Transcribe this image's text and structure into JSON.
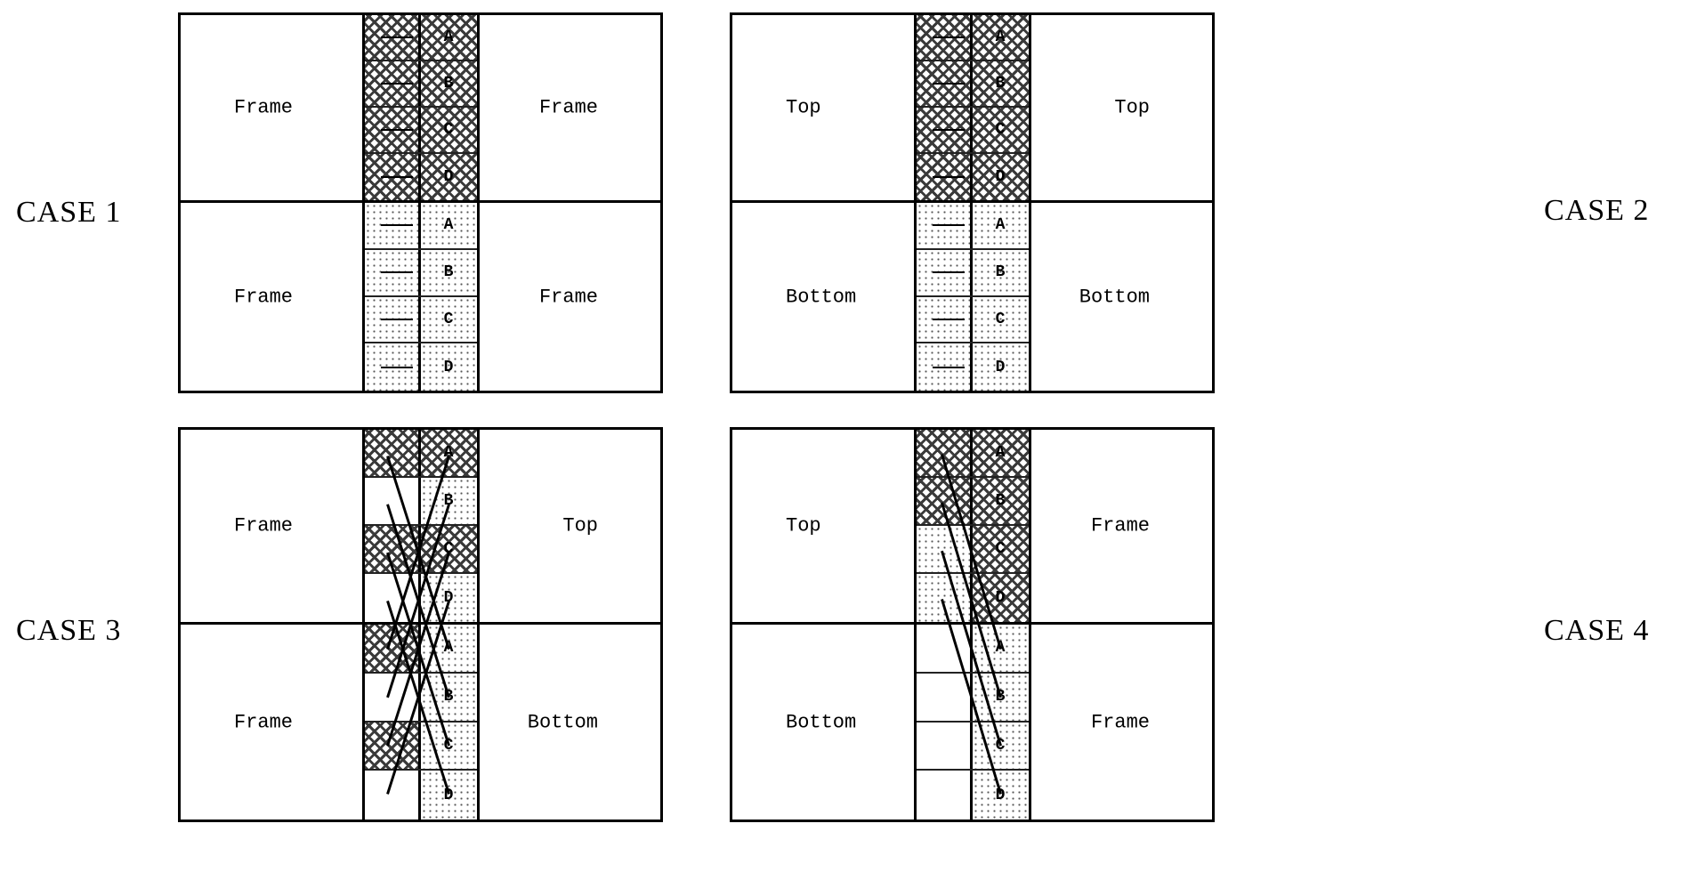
{
  "labels": {
    "case1": "CASE 1",
    "case2": "CASE 2",
    "case3": "CASE 3",
    "case4": "CASE 4"
  },
  "rows": [
    "A",
    "B",
    "C",
    "D"
  ],
  "cases": {
    "1": {
      "topLeft": "Frame",
      "topRight": "Frame",
      "bottomLeft": "Frame",
      "bottomRight": "Frame",
      "topPattern": "hatch",
      "bottomPattern": "dots",
      "topLeftCol": "hatch",
      "bottomLeftCol": "dots"
    },
    "2": {
      "topLeft": "Top",
      "topRight": "Top",
      "bottomLeft": "Bottom",
      "bottomRight": "Bottom",
      "topPattern": "hatch",
      "bottomPattern": "dots",
      "topLeftCol": "hatch",
      "bottomLeftCol": "dots"
    },
    "3": {
      "topLeft": "Frame",
      "topRight": "Top",
      "bottomLeft": "Frame",
      "bottomRight": "Bottom",
      "topRowPatterns": [
        "hatch",
        "plain",
        "hatch",
        "plain"
      ],
      "bottomRowPatterns": [
        "hatch",
        "plain",
        "hatch",
        "plain"
      ],
      "topRightPatterns": [
        "hatch",
        "dots",
        "hatch",
        "dots"
      ],
      "bottomRightPatterns": [
        "dots",
        "dots",
        "dots",
        "dots"
      ]
    },
    "4": {
      "topLeft": "Top",
      "topRight": "Frame",
      "bottomLeft": "Bottom",
      "bottomRight": "Frame",
      "topRowPatterns": [
        "hatch",
        "hatch",
        "dots",
        "dots"
      ],
      "bottomRowPatterns": [
        "plain",
        "plain",
        "plain",
        "plain"
      ],
      "topRightPatterns": [
        "hatch",
        "hatch",
        "hatch",
        "hatch"
      ],
      "bottomRightPatterns": [
        "dots",
        "dots",
        "dots",
        "dots"
      ]
    }
  }
}
